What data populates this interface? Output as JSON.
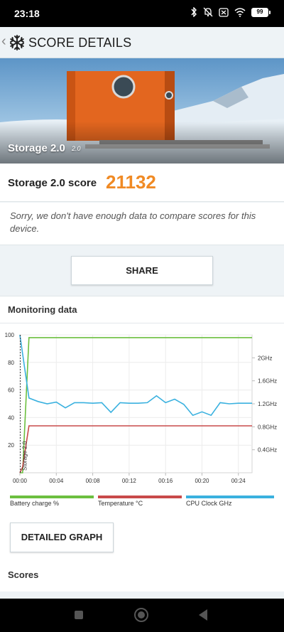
{
  "status": {
    "time": "23:18",
    "battery": "99",
    "icons": [
      "bluetooth-icon",
      "mute-icon",
      "no-sim-icon",
      "wifi-icon",
      "battery-icon"
    ]
  },
  "app_bar": {
    "title": "SCORE DETAILS",
    "icons": [
      "back-icon",
      "snowflake-icon"
    ]
  },
  "hero": {
    "title": "Storage 2.0",
    "version": "2.0"
  },
  "score": {
    "label": "Storage 2.0 score",
    "value": "21132",
    "color": "#f08a24"
  },
  "notice": "Sorry, we don't have enough data to compare scores for this device.",
  "share_label": "SHARE",
  "monitoring": {
    "title": "Monitoring data",
    "detailed_label": "DETAILED GRAPH",
    "scores_title": "Scores"
  },
  "chart_data": {
    "type": "line",
    "x_ticks": [
      "00:00",
      "00:04",
      "00:08",
      "00:12",
      "00:16",
      "00:20",
      "00:24"
    ],
    "y_left_ticks": [
      "100",
      "80",
      "60",
      "40",
      "20"
    ],
    "y_right_ticks": [
      "2GHz",
      "1.6GHz",
      "1.2GHz",
      "0.8GHz",
      "0.4GHz"
    ],
    "ylim_left": [
      0,
      100
    ],
    "ylim_right": [
      0,
      2.4
    ],
    "xlim": [
      0,
      25.5
    ],
    "marker_label": "Storage 2.0",
    "marker_x": 0.05,
    "series": [
      {
        "name": "Battery charge %",
        "axis": "left",
        "color": "#6cbf3f",
        "x": [
          0,
          0.3,
          1.0,
          25.5
        ],
        "y": [
          0,
          0,
          98,
          98
        ]
      },
      {
        "name": "Temperature °C",
        "axis": "left",
        "color": "#c94a4a",
        "x": [
          0,
          0.3,
          1.0,
          25.5
        ],
        "y": [
          0,
          4,
          34,
          34
        ]
      },
      {
        "name": "CPU Clock GHz",
        "axis": "right",
        "color": "#3ab1df",
        "x": [
          0,
          1,
          2,
          3,
          4,
          5,
          6,
          7,
          8,
          9,
          10,
          11,
          12,
          13,
          14,
          15,
          16,
          17,
          18,
          19,
          20,
          21,
          22,
          23,
          24,
          25.5
        ],
        "y": [
          2.4,
          1.3,
          1.24,
          1.2,
          1.23,
          1.13,
          1.22,
          1.22,
          1.21,
          1.22,
          1.05,
          1.22,
          1.21,
          1.21,
          1.22,
          1.34,
          1.22,
          1.28,
          1.19,
          1.0,
          1.06,
          1.0,
          1.22,
          1.2,
          1.21,
          1.21
        ]
      }
    ]
  }
}
